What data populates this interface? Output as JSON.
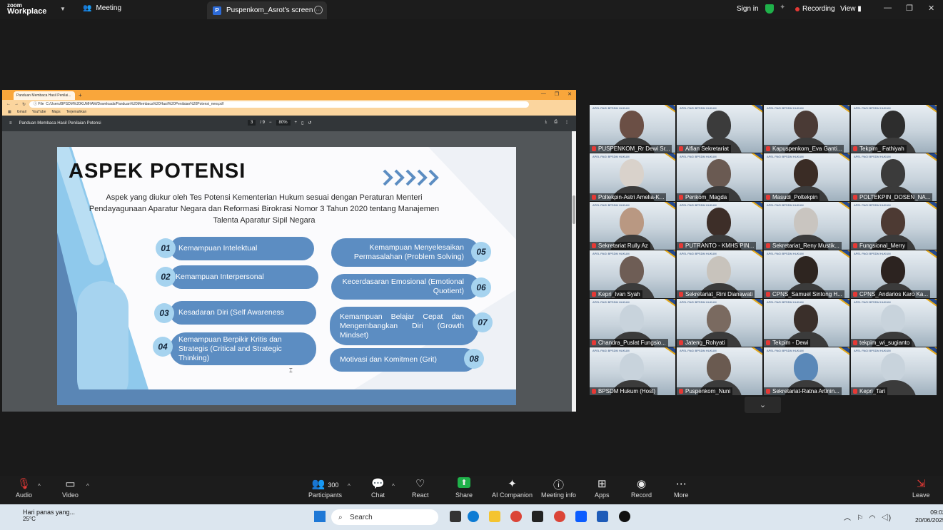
{
  "topbar": {
    "logo_line1": "zoom",
    "logo_line2": "Workplace",
    "meeting_label": "Meeting",
    "screen_tab_badge": "P",
    "screen_tab_label": "Puspenkom_Asrot's screen",
    "signin": "Sign in",
    "recording": "Recording",
    "view": "View"
  },
  "browser": {
    "tab_title": "Panduan Membaca Hasil Penilai...",
    "address": "C:/Users/BPSDM%20KUMHAM/Downloads/Panduan%20Membaca%20Hasil%20Penilaian%20Potensi_new.pdf",
    "file_label": "File",
    "bookmarks": [
      "Gmail",
      "YouTube",
      "Maps",
      "Terjemahkan"
    ]
  },
  "pdf": {
    "title": "Panduan Membaca Hasil Penilaian Potensi",
    "page_current": "3",
    "page_total": "/ 9",
    "zoom": "80%"
  },
  "slide": {
    "heading": "ASPEK POTENSI",
    "intro": "Aspek yang diukur oleh Tes Potensi Kementerian Hukum  sesuai dengan Peraturan Menteri Pendayagunaan Aparatur Negara dan Reformasi Birokrasi Nomor 3 Tahun 2020 tentang Manajemen Talenta Aparatur Sipil Negara",
    "items": [
      {
        "num": "01",
        "label": "Kemampuan Intelektual"
      },
      {
        "num": "02",
        "label": "Kemampuan Interpersonal"
      },
      {
        "num": "03",
        "label": "Kesadaran Diri (Self Awareness"
      },
      {
        "num": "04",
        "label": "Kemampuan Berpikir Kritis dan Strategis (Critical and Strategic Thinking)"
      },
      {
        "num": "05",
        "label": "Kemampuan Menyelesaikan Permasalahan (Problem Solving)"
      },
      {
        "num": "06",
        "label": "Kecerdasaran Emosional (Emotional Quotient)"
      },
      {
        "num": "07",
        "label": "Kemampuan Belajar Cepat dan Mengembangkan Diri (Growth Mindset)"
      },
      {
        "num": "08",
        "label": "Motivasi dan Komitmen (Grit)"
      }
    ]
  },
  "participants": [
    "PUSPENKOM_Rr Dewi Sr...",
    "Alfian Sekretariat",
    "Kapuspenkom_Eva Ganti...",
    "Tekpim_ Fathiyah",
    "Poltekpin-Astri Amelia-K...",
    "Penkom_Magda",
    "Masudi_Poltekpin",
    "POLTEKPIN_DOSEN_NA...",
    "Sekretariat Rully Az",
    "PUTRANTO - KMHS PIN...",
    "Sekretariat_Reny Mustik...",
    "Fungsional_Merry",
    "Kepri_Ivan Syah",
    "Sekretariat_Rini Dianawati",
    "CPNS_Samuel Sintong H...",
    "CPNS_Andarios Karo Ka...",
    "Chandra_Puslat Fungsio...",
    "Jateng_Rohyati",
    "Tekpim - Dewi",
    "tekpim_wi_sugianto",
    "BPSDM Hukum (Host)",
    "Puspenkom_Nuni",
    "Sekretariat-Ratna Artinin...",
    "Kepri_Tari"
  ],
  "tile_header": "APEL PAGI BPSDM HUKUM",
  "toolbar": {
    "audio": "Audio",
    "video": "Video",
    "participants": "Participants",
    "participants_count": "300",
    "chat": "Chat",
    "react": "React",
    "share": "Share",
    "ai": "AI Companion",
    "info": "Meeting info",
    "apps": "Apps",
    "record": "Record",
    "more": "More",
    "leave": "Leave"
  },
  "taskbar": {
    "weather_text": "Hari panas yang...",
    "temperature": "25°C",
    "search": "Search",
    "time": "09:02",
    "date": "20/06/2025"
  },
  "colors": {
    "accent_orange": "#f9a63b",
    "pill_blue": "#5c8dc2",
    "num_blue": "#a6d3ef",
    "share_green": "#1fb14a",
    "recording_red": "#e53935"
  }
}
